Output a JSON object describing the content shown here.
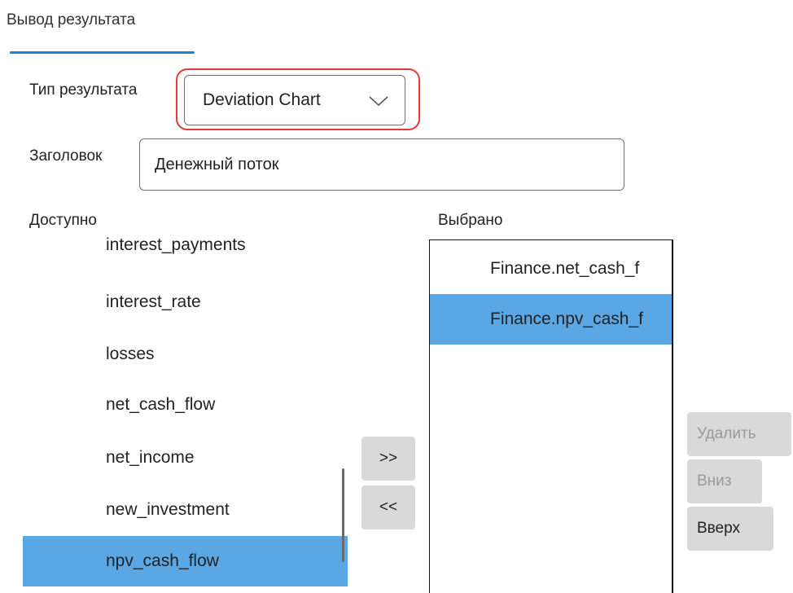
{
  "tab": {
    "label": "Вывод результата"
  },
  "result_type": {
    "label": "Тип результата",
    "value": "Deviation Chart",
    "highlight_color": "#e53935"
  },
  "heading": {
    "label": "Заголовок",
    "value": "Денежный поток"
  },
  "available": {
    "label": "Доступно",
    "items": [
      {
        "label": "interest_payments",
        "selected": false
      },
      {
        "label": "interest_rate",
        "selected": false
      },
      {
        "label": "losses",
        "selected": false
      },
      {
        "label": "net_cash_flow",
        "selected": false
      },
      {
        "label": "net_income",
        "selected": false
      },
      {
        "label": "new_investment",
        "selected": false
      },
      {
        "label": "npv_cash_flow",
        "selected": true
      }
    ]
  },
  "selected": {
    "label": "Выбрано",
    "items": [
      {
        "label": "Finance.net_cash_f",
        "selected": false
      },
      {
        "label": "Finance.npv_cash_f",
        "selected": true
      }
    ]
  },
  "move_buttons": {
    "add": ">>",
    "remove": "<<"
  },
  "side_buttons": {
    "delete": "Удалить",
    "down": "Вниз",
    "up": "Вверх"
  },
  "colors": {
    "accent": "#1f7fd1",
    "selection": "#5aa7e4",
    "button_bg": "#d9d9d9",
    "disabled_text": "#9a9a9a"
  }
}
